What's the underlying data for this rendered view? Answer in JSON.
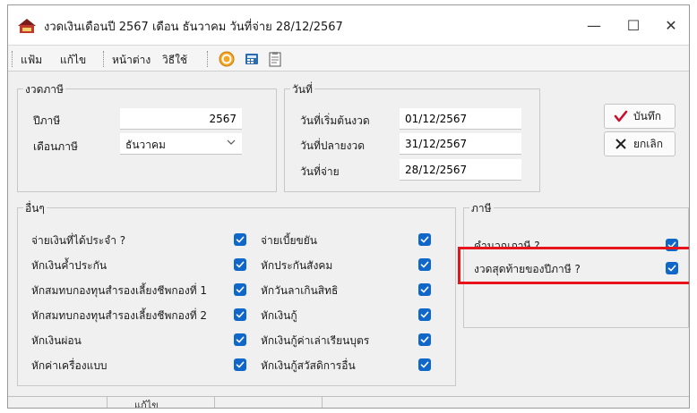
{
  "window": {
    "title": "งวดเงินเดือนปี 2567 เดือน ธันวาคม วันที่จ่าย 28/12/2567"
  },
  "window_controls": {
    "minimize": "—",
    "maximize": "☐",
    "close": "✕"
  },
  "menu": {
    "file": "แฟ้ม",
    "edit": "แก้ไข",
    "window": "หน้าต่าง",
    "help": "วิธีใช้"
  },
  "toolbar_icons": [
    "help-circle-icon",
    "calculator-icon",
    "clipboard-icon"
  ],
  "period": {
    "group_title": "งวดภาษี",
    "tax_year_label": "ปีภาษี",
    "tax_year_value": "2567",
    "tax_month_label": "เดือนภาษี",
    "tax_month_value": "ธันวาคม"
  },
  "dates": {
    "group_title": "วันที่",
    "start_label": "วันที่เริ่มต้นงวด",
    "start_value": "01/12/2567",
    "end_label": "วันที่ปลายงวด",
    "end_value": "31/12/2567",
    "pay_label": "วันที่จ่าย",
    "pay_value": "28/12/2567"
  },
  "buttons": {
    "save": "บันทึก",
    "cancel": "ยกเลิก"
  },
  "others": {
    "group_title": "อื่นๆ",
    "left_items": [
      {
        "label": "จ่ายเงินที่ได้ประจำ ?",
        "checked": true
      },
      {
        "label": "หักเงินค้ำประกัน",
        "checked": true
      },
      {
        "label": "หักสมทบกองทุนสำรองเลี้ยงชีพกองที่ 1",
        "checked": true
      },
      {
        "label": "หักสมทบกองทุนสำรองเลี้ยงชีพกองที่ 2",
        "checked": true
      },
      {
        "label": "หักเงินผ่อน",
        "checked": true
      },
      {
        "label": "หักค่าเครื่องแบบ",
        "checked": true
      }
    ],
    "right_items": [
      {
        "label": "จ่ายเบี้ยขยัน",
        "checked": true
      },
      {
        "label": "หักประกันสังคม",
        "checked": true
      },
      {
        "label": "หักวันลาเกินสิทธิ",
        "checked": true
      },
      {
        "label": "หักเงินกู้",
        "checked": true
      },
      {
        "label": "หักเงินกู้ค่าเล่าเรียนบุตร",
        "checked": true
      },
      {
        "label": "หักเงินกู้สวัสดิการอื่น",
        "checked": true
      }
    ]
  },
  "tax": {
    "group_title": "ภาษี",
    "items": [
      {
        "label": "คำนวณภาษี ?",
        "checked": true
      },
      {
        "label": "งวดสุดท้ายของปีภาษี ?",
        "checked": true
      }
    ]
  },
  "status": {
    "mode": "แก้ไข"
  },
  "colors": {
    "checkbox": "#0f67c9",
    "highlight": "#e8141b",
    "save_check": "#c8102e"
  }
}
